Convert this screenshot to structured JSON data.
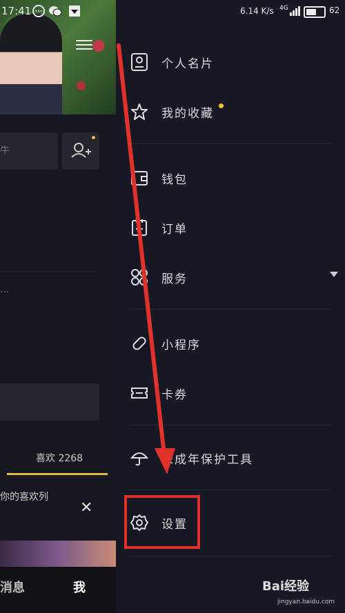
{
  "status_bar": {
    "time": "17:41",
    "speed": "6.14",
    "speed_unit": "K/s",
    "network": "4G",
    "battery": "62"
  },
  "profile": {
    "search_placeholder": "牛",
    "ellipsis": "...",
    "likes_tab": "喜欢 2268",
    "likes_list": "你的喜欢列",
    "nav": {
      "messages": "消息",
      "me": "我"
    }
  },
  "drawer": {
    "items": [
      {
        "label": "个人名片",
        "icon": "profile-card-icon"
      },
      {
        "label": "我的收藏",
        "icon": "star-icon",
        "badge": true
      },
      {
        "label": "钱包",
        "icon": "wallet-icon"
      },
      {
        "label": "订单",
        "icon": "order-icon"
      },
      {
        "label": "服务",
        "icon": "services-icon",
        "expandable": true
      },
      {
        "label": "小程序",
        "icon": "mini-program-icon"
      },
      {
        "label": "卡券",
        "icon": "coupon-icon"
      },
      {
        "label": "未成年保护工具",
        "icon": "umbrella-icon"
      },
      {
        "label": "设置",
        "icon": "gear-icon"
      }
    ]
  },
  "annotation": {
    "color": "#e0322b"
  },
  "watermark": {
    "brand": "Bai经验",
    "url": "jingyan.baidu.com"
  }
}
